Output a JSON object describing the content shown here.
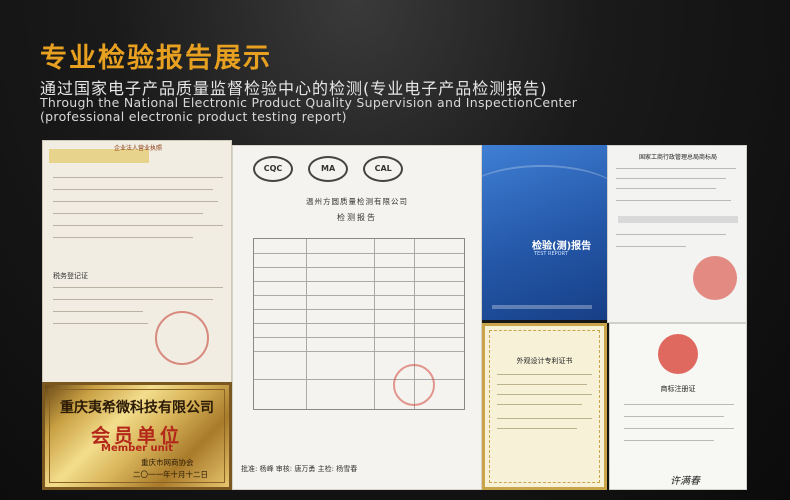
{
  "header": {
    "title": "专业检验报告展示",
    "subtitle_cn": "通过国家电子产品质量监督检验中心的检测(专业电子产品检测报告)",
    "subtitle_en_line1": "Through the National Electronic Product Quality Supervision and InspectionCenter",
    "subtitle_en_line2": "(professional electronic product testing report)"
  },
  "documents": {
    "tax_cert": {
      "top_band": "企业法人营业执照",
      "section_label": "税务登记证"
    },
    "plaque": {
      "company": "重庆夷希微科技有限公司",
      "title": "会员单位",
      "title_en": "Member unit",
      "issuer": "重庆市网商协会",
      "date": "二〇一一年十月十二日"
    },
    "test_report": {
      "logo1": "CQC",
      "logo2": "MA",
      "logo3": "CAL",
      "org": "温州方圆质量检测有限公司",
      "title": "检测报告",
      "signatures": "批准: 杨峰    审核: 唐万勇    主检: 杨雪春"
    },
    "report_cover": {
      "title": "检验(测)报告",
      "title_en": "TEST REPORT"
    },
    "trademark_reg": {
      "header": "国家工商行政管理总局商标局"
    },
    "patent_cert": {
      "title": "外观设计专利证书"
    },
    "trademark_cert": {
      "title": "商标注册证",
      "signature": "许满春"
    }
  }
}
